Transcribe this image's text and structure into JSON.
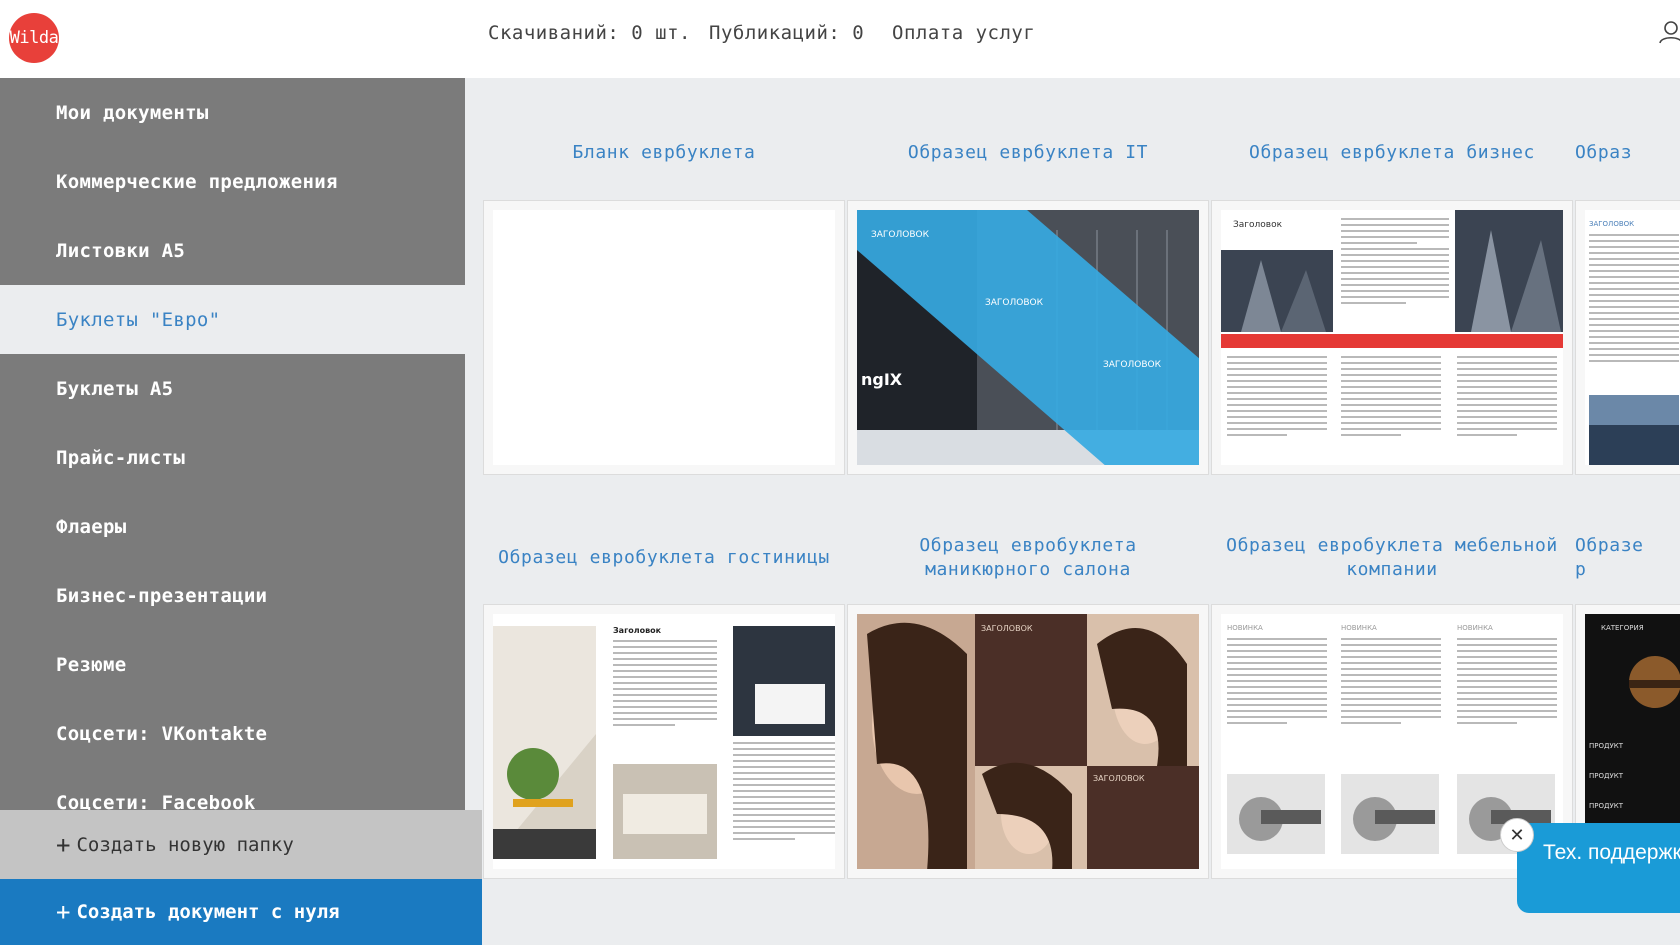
{
  "header": {
    "logo_text": "Wilda",
    "downloads": "Скачиваний: 0 шт.",
    "publications": "Публикаций: 0",
    "payment": "Оплата услуг"
  },
  "sidebar": {
    "items": [
      {
        "label": "Мои документы",
        "active": false
      },
      {
        "label": "Коммерческие предложения",
        "active": false
      },
      {
        "label": "Листовки А5",
        "active": false
      },
      {
        "label": "Буклеты \"Евро\"",
        "active": true
      },
      {
        "label": "Буклеты А5",
        "active": false
      },
      {
        "label": "Прайс-листы",
        "active": false
      },
      {
        "label": "Флаеры",
        "active": false
      },
      {
        "label": "Бизнес-презентации",
        "active": false
      },
      {
        "label": "Резюме",
        "active": false
      },
      {
        "label": "Соцсети: VKontakte",
        "active": false
      },
      {
        "label": "Соцсети: Facebook",
        "active": false
      }
    ],
    "new_folder": "Создать новую папку",
    "new_document": "Создать документ с нуля"
  },
  "templates": {
    "row1": [
      {
        "title": "Бланк еврбуклета"
      },
      {
        "title": "Образец еврбуклета IT"
      },
      {
        "title": "Образец еврбуклета бизнес"
      },
      {
        "title": "Образ"
      }
    ],
    "row2": [
      {
        "title": "Образец евробуклета гостиницы"
      },
      {
        "title": "Образец евробуклета\nманикюрного салона"
      },
      {
        "title": "Образец евробуклета мебельной\nкомпании"
      },
      {
        "title": "Образе\nр"
      }
    ],
    "thumb_text": {
      "zag": "ЗАГОЛОВОК",
      "zag_title": "Заголовок",
      "kategoria": "КАТЕГОРИЯ",
      "product": "ПРОДУКТ",
      "brand": "ngIX",
      "novinka": "НОВИНКА"
    }
  },
  "support": {
    "label": "Тех. поддержка",
    "close": "✕"
  },
  "colors": {
    "accent": "#3a83c4",
    "sidebar_bg": "#7b7b7b",
    "cta_bg": "#1a7ac1",
    "logo_bg": "#e8403a",
    "support_bg": "#1a9bd7"
  }
}
